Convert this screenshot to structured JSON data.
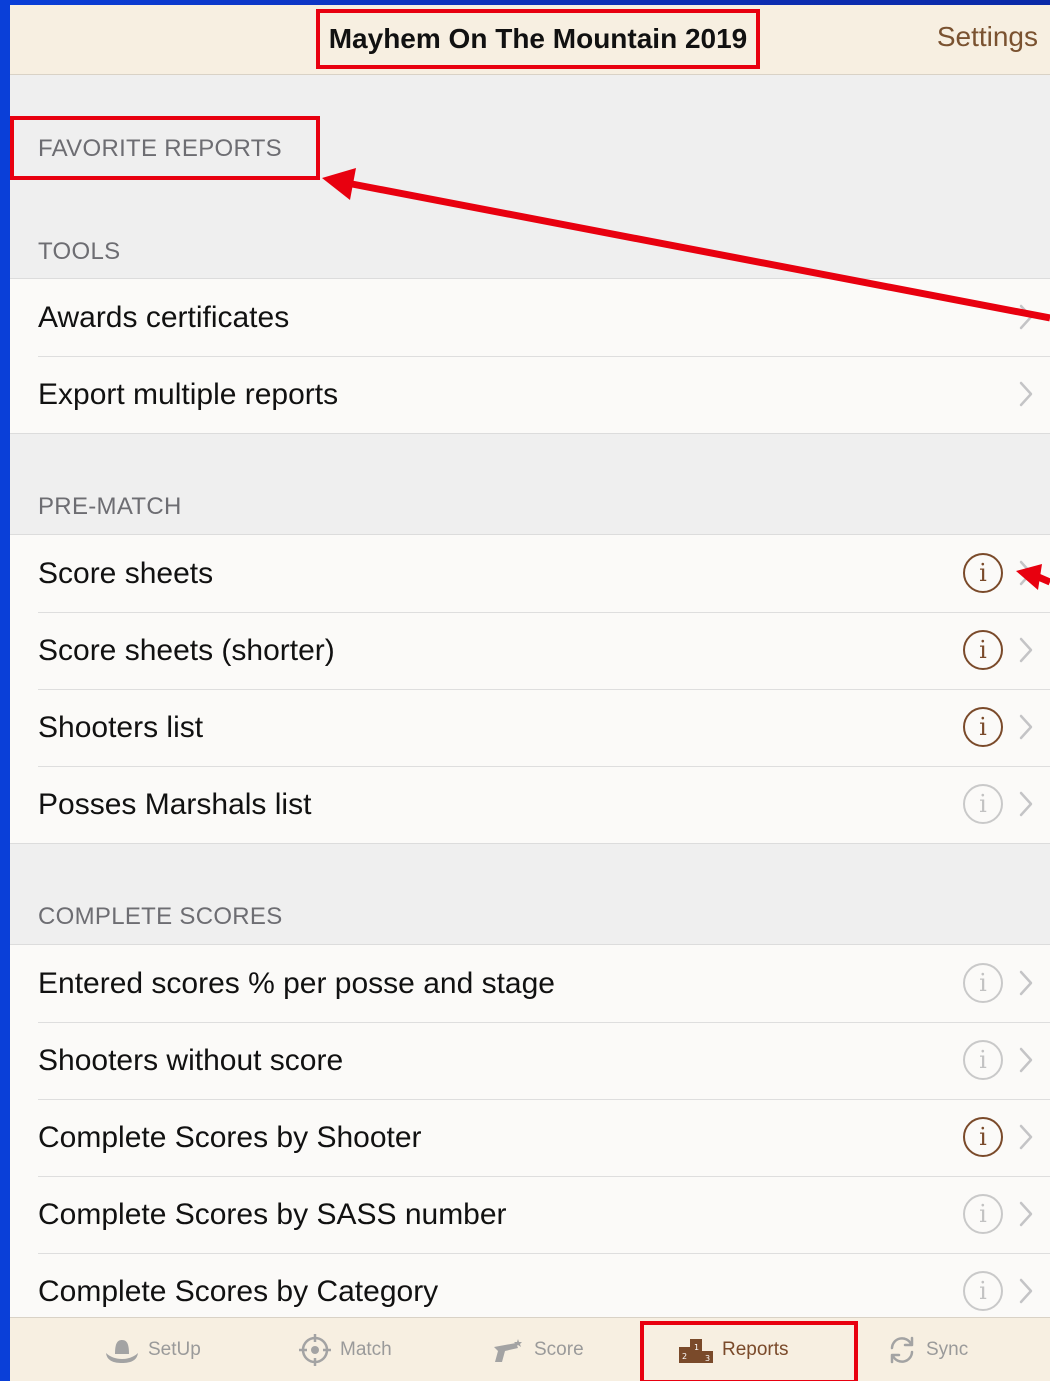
{
  "navbar": {
    "title": "Mayhem On The Mountain 2019",
    "settings_label": "Settings"
  },
  "sections": {
    "favorites": {
      "header": "FAVORITE REPORTS"
    },
    "tools": {
      "header": "TOOLS",
      "items": [
        {
          "label": "Awards certificates"
        },
        {
          "label": "Export multiple reports"
        }
      ]
    },
    "prematch": {
      "header": "PRE-MATCH",
      "items": [
        {
          "label": "Score sheets",
          "info_active": true
        },
        {
          "label": "Score sheets (shorter)",
          "info_active": true
        },
        {
          "label": "Shooters list",
          "info_active": true
        },
        {
          "label": "Posses Marshals list",
          "info_active": false
        }
      ]
    },
    "complete": {
      "header": "COMPLETE SCORES",
      "items": [
        {
          "label": "Entered scores % per posse and stage",
          "info_active": false
        },
        {
          "label": "Shooters without score",
          "info_active": false
        },
        {
          "label": "Complete Scores by Shooter",
          "info_active": true
        },
        {
          "label": "Complete Scores by SASS number",
          "info_active": false
        },
        {
          "label": "Complete Scores by Category",
          "info_active": false
        }
      ]
    }
  },
  "tabbar": {
    "tabs": [
      {
        "label": "SetUp",
        "icon": "cowboy-hat-icon"
      },
      {
        "label": "Match",
        "icon": "crosshair-icon"
      },
      {
        "label": "Score",
        "icon": "revolver-icon"
      },
      {
        "label": "Reports",
        "icon": "podium-icon",
        "selected": true
      },
      {
        "label": "Sync",
        "icon": "sync-icon"
      }
    ]
  },
  "colors": {
    "accent_brown": "#7a4a2a",
    "annotation_red": "#e8000f",
    "bar_background": "#f7efe1",
    "list_background": "#efefef"
  }
}
